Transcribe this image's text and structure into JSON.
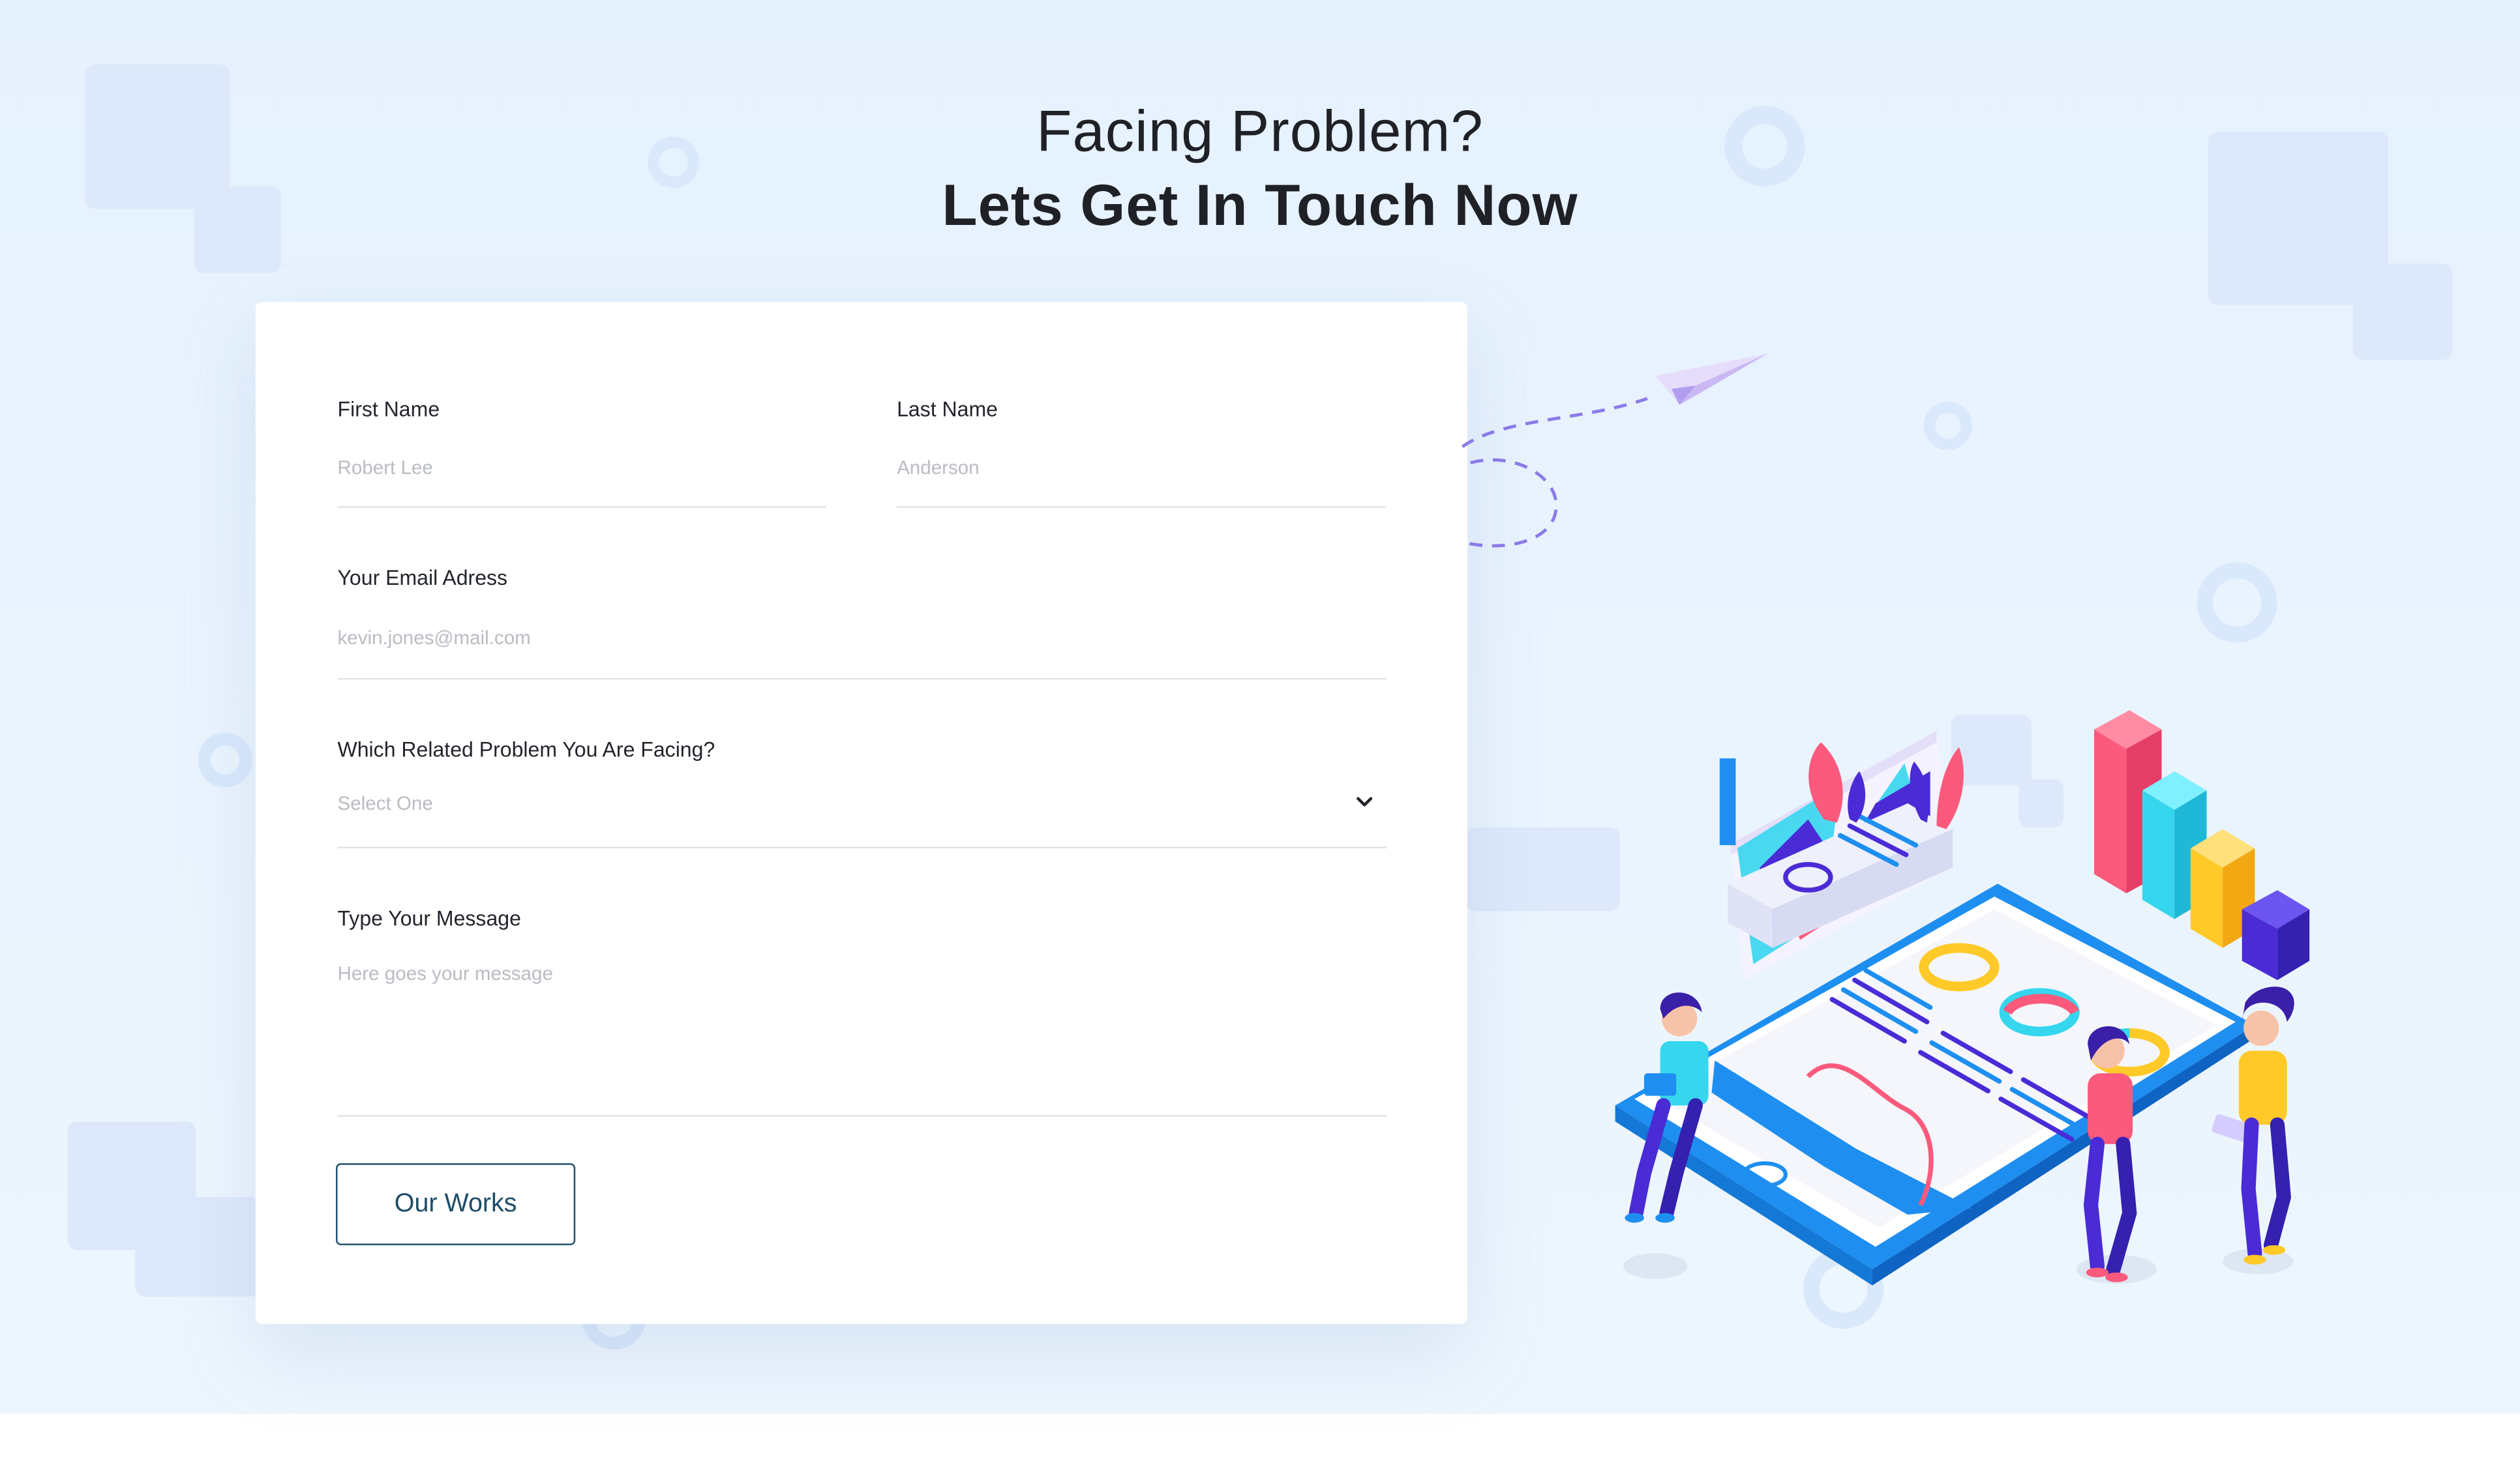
{
  "heading": {
    "line1": "Facing Problem?",
    "line2": "Lets Get In Touch Now"
  },
  "form": {
    "first_name": {
      "label": "First Name",
      "placeholder": "Robert Lee"
    },
    "last_name": {
      "label": "Last Name",
      "placeholder": "Anderson"
    },
    "email": {
      "label": "Your Email Adress",
      "placeholder": "kevin.jones@mail.com"
    },
    "problem": {
      "label": "Which Related Problem You Are Facing?",
      "selected": "Select One"
    },
    "message": {
      "label": "Type Your Message",
      "placeholder": "Here goes your message"
    },
    "submit_label": "Our Works"
  },
  "icons": {
    "select_chevron": "chevron-down-icon",
    "paper_plane": "paper-plane-icon",
    "illustration": "team-analytics-illustration"
  },
  "colors": {
    "background": "#e5f1fd",
    "card": "#ffffff",
    "heading_text": "#1f2127",
    "label_text": "#22252b",
    "placeholder_text": "#b9bcc2",
    "button_border": "#21526c",
    "accent_blue": "#1e8ff0",
    "accent_pink": "#fb5a7c",
    "accent_cyan": "#35d6ee",
    "accent_yellow": "#ffc928",
    "accent_purple": "#4a2bd6"
  }
}
